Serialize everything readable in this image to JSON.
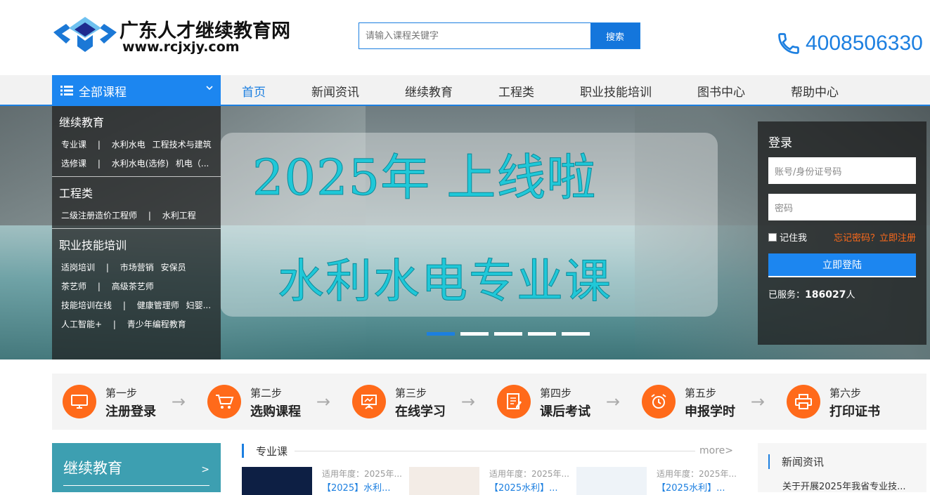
{
  "site": {
    "title": "广东人才继续教育网",
    "url": "www.rcjxjy.com",
    "phone": "4008506330"
  },
  "search": {
    "placeholder": "请输入课程关键字",
    "button": "搜索"
  },
  "nav": {
    "all_courses": "全部课程",
    "items": [
      "首页",
      "新闻资讯",
      "继续教育",
      "工程类",
      "职业技能培训",
      "图书中心",
      "帮助中心"
    ]
  },
  "side_menu": {
    "groups": [
      {
        "title": "继续教育",
        "rows": [
          [
            "专业课",
            "|",
            "水利水电",
            "工程技术与建筑"
          ],
          [
            "选修课",
            "|",
            "水利水电(选修)",
            "机电（..."
          ]
        ]
      },
      {
        "title": "工程类",
        "rows": [
          [
            "二级注册造价工程师",
            "|",
            "水利工程"
          ]
        ]
      },
      {
        "title": "职业技能培训",
        "rows": [
          [
            "适岗培训",
            "|",
            "市场营销",
            "安保员"
          ],
          [
            "茶艺师",
            "|",
            "高级茶艺师"
          ],
          [
            "技能培训在线",
            "|",
            "健康管理师",
            "妇婴..."
          ],
          [
            "人工智能+",
            "|",
            "青少年编程教育"
          ]
        ]
      }
    ]
  },
  "banner": {
    "line1": "2025年  上线啦",
    "line2": "水利水电专业课",
    "slides": 5,
    "active_slide": 1
  },
  "login": {
    "title": "登录",
    "account_placeholder": "账号/身份证号码",
    "password_placeholder": "密码",
    "remember": "记住我",
    "forgot": "忘记密码？立即注册",
    "button": "立即登陆",
    "served_label": "已服务：",
    "served_count": "186027",
    "served_unit": "人"
  },
  "steps": [
    {
      "label": "第一步",
      "name": "注册登录",
      "icon": "monitor-icon"
    },
    {
      "label": "第二步",
      "name": "选购课程",
      "icon": "cart-icon"
    },
    {
      "label": "第三步",
      "name": "在线学习",
      "icon": "presentation-icon"
    },
    {
      "label": "第四步",
      "name": "课后考试",
      "icon": "exam-icon"
    },
    {
      "label": "第五步",
      "name": "申报学时",
      "icon": "alarm-clock-icon"
    },
    {
      "label": "第六步",
      "name": "打印证书",
      "icon": "printer-icon"
    }
  ],
  "bottom_left": {
    "title": "继续教育",
    "arrow": ">"
  },
  "course_section": {
    "title": "专业课",
    "more": "more>",
    "cards": [
      {
        "meta": "适用年度：2025年...",
        "title": "【2025】水利..."
      },
      {
        "meta": "适用年度：2025年...",
        "title": "【2025水利】..."
      },
      {
        "meta": "适用年度：2025年...",
        "title": "【2025水利】..."
      }
    ]
  },
  "news": {
    "title": "新闻资讯",
    "first_item": "关于开展2025年我省专业技..."
  },
  "colors": {
    "primary": "#1c86f0",
    "accent": "#ff6a1a",
    "teal": "#3d9fb1"
  }
}
